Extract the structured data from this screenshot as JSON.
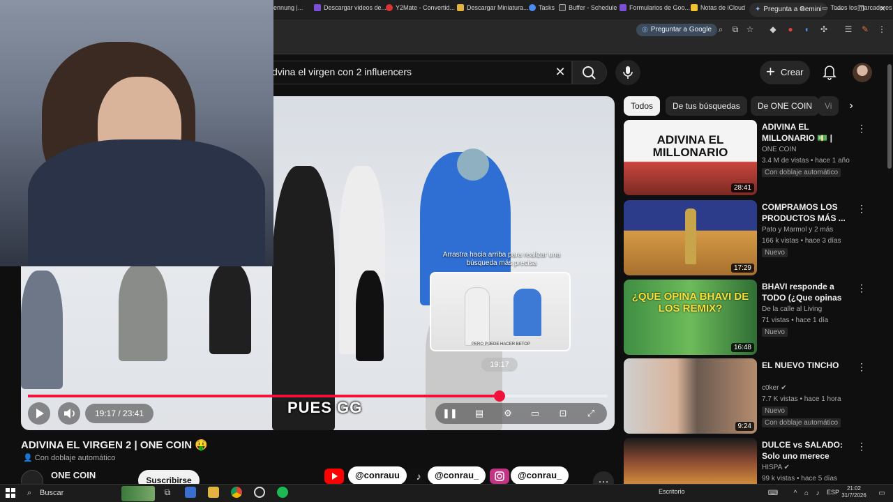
{
  "browser": {
    "gemini_button": "Pregunta a Gemini",
    "google_button": "Preguntar a Google",
    "bookmarks": [
      "ennung |...",
      "Descargar videos de...",
      "Y2Mate - Convertid...",
      "Descargar Miniatura...",
      "Tasks",
      "Buffer - Schedule",
      "Formularios de Goo...",
      "Notas de iCloud"
    ],
    "all_bookmarks": "Todos los marcadores",
    "bookmarks_overflow": "»"
  },
  "youtube": {
    "search_query": "dvina el virgen con 2 influencers",
    "create_label": "Crear",
    "player": {
      "current_time": "19:17",
      "duration": "23:41",
      "time_display": "19:17 / 23:41",
      "progress_fraction": 0.814,
      "preview_time": "19:17",
      "overlay_hint": "Arrastra hacia arriba para realizar una búsqueda más precisa",
      "caption": "PUES GG",
      "preview_caption": "PERO PUEDE HACER BETOP"
    },
    "video": {
      "title": "ADIVINA EL VIRGEN 2 | ONE COIN 🤑",
      "dubbing": "Con doblaje automático",
      "channel": "ONE COIN",
      "subscribe": "Suscribirse",
      "socials": [
        "@conrauu",
        "@conrau_",
        "@conrau_"
      ],
      "more": "…"
    },
    "chips": [
      "Todos",
      "De tus búsquedas",
      "De ONE COIN",
      "Vi"
    ],
    "recommendations": [
      {
        "title": "ADIVINA EL MILLONARIO 💵 | ONE...",
        "channel": "ONE COIN",
        "meta": "3.4 M de vistas • hace 1 año",
        "badge": "Con doblaje automático",
        "duration": "28:41",
        "thumb_text": "ADIVINA EL MILLONARIO",
        "thumb_color": "#c9463d"
      },
      {
        "title": "COMPRAMOS LOS PRODUCTOS MÁS ...",
        "channel": "Pato y Marmol y 2 más",
        "meta": "166 k vistas • hace 3 días",
        "badge": "Nuevo",
        "duration": "17:29",
        "thumb_text": "",
        "thumb_color": "#d59a45"
      },
      {
        "title": "BHAVI responde a TODO (¿Que opinas de...",
        "channel": "De la calle al Living",
        "meta": "71 vistas • hace 1 día",
        "badge": "Nuevo",
        "duration": "16:48",
        "thumb_text": "¿QUE OPINA BHAVI DE LOS REMIX?",
        "thumb_color": "#3f8e43"
      },
      {
        "title": "EL NUEVO TINCHO",
        "channel": "c0ker",
        "meta": "7.7 K vistas • hace 1 hora",
        "badge": "Nuevo",
        "badge2": "Con doblaje automático",
        "duration": "9:24",
        "thumb_text": "",
        "thumb_color": "#6a5a50"
      },
      {
        "title": "DULCE vs SALADO: Solo uno merece exist...",
        "channel": "HISPA",
        "meta": "99 k vistas • hace 5 días",
        "badge": "",
        "duration": "",
        "thumb_text": "",
        "thumb_color": "#8a4a32"
      }
    ]
  },
  "taskbar": {
    "search_placeholder": "Buscar",
    "desktop_label": "Escritorio",
    "language": "ESP",
    "time": "21:02",
    "date": "31/7/2026"
  },
  "colors": {
    "accent": "#f0123a",
    "background": "#0f0f0f"
  }
}
